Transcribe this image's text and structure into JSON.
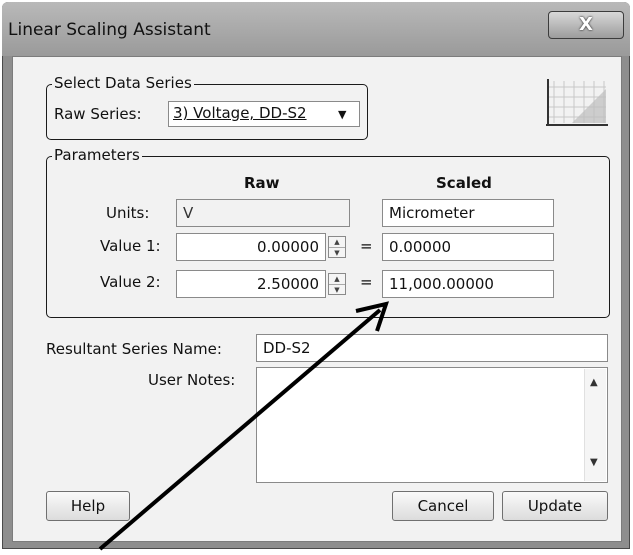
{
  "window": {
    "title": "Linear Scaling Assistant",
    "close_label": "X"
  },
  "select_series": {
    "legend": "Select Data Series",
    "raw_series_label": "Raw Series:",
    "raw_series_value": "3) Voltage, DD-S2"
  },
  "parameters": {
    "legend": "Parameters",
    "raw_header": "Raw",
    "scaled_header": "Scaled",
    "units_label": "Units:",
    "units_raw": "V",
    "units_scaled": "Micrometer",
    "value1_label": "Value 1:",
    "value1_raw": "0.00000",
    "value1_scaled": "0.00000",
    "value2_label": "Value 2:",
    "value2_raw": "2.50000",
    "value2_scaled": "11,000.00000",
    "equals": "="
  },
  "resultant": {
    "label": "Resultant Series Name:",
    "value": "DD-S2"
  },
  "notes": {
    "label": "User Notes:",
    "value": ""
  },
  "buttons": {
    "help": "Help",
    "cancel": "Cancel",
    "update": "Update"
  }
}
